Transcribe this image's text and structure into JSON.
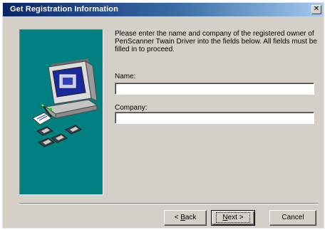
{
  "window": {
    "title": "Get Registration Information",
    "close_glyph": "✕"
  },
  "instructions": "Please enter the name and company of the registered owner of PenScanner Twain Driver into the fields below. All fields must be filled in to proceed.",
  "form": {
    "name_label": "Name:",
    "name_value": "",
    "company_label": "Company:",
    "company_value": ""
  },
  "buttons": {
    "back_accel": "B",
    "back_rest": "ack",
    "back_prefix": "< ",
    "next_accel": "N",
    "next_rest": "ext >",
    "cancel_label": "Cancel"
  },
  "illustration": {
    "icon": "computer-setup-icon",
    "panel_color": "#008080"
  }
}
